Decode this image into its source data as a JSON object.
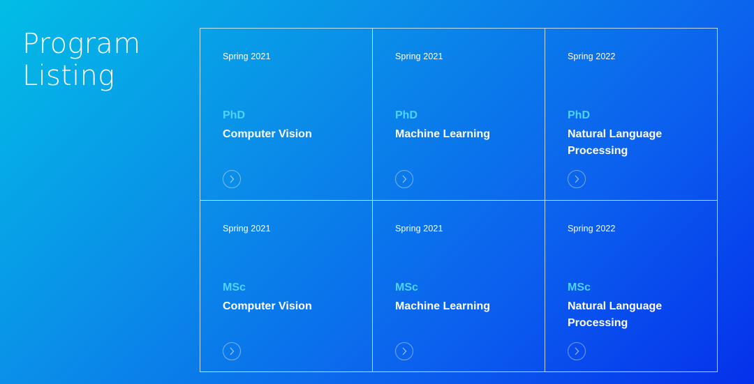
{
  "page": {
    "title": "Program Listing"
  },
  "colors": {
    "degree_accent": "#4fd3ff",
    "text": "#ffffff",
    "gradient_start": "#02bde6",
    "gradient_end": "#0530ec"
  },
  "programs": [
    {
      "term": "Spring 2021",
      "degree": "PhD",
      "name": "Computer Vision",
      "icon": "chevron-right-circle-icon"
    },
    {
      "term": "Spring 2021",
      "degree": "PhD",
      "name": "Machine Learning",
      "icon": "chevron-right-circle-icon"
    },
    {
      "term": "Spring 2022",
      "degree": "PhD",
      "name": "Natural Language Processing",
      "icon": "chevron-right-circle-icon"
    },
    {
      "term": "Spring 2021",
      "degree": "MSc",
      "name": "Computer Vision",
      "icon": "chevron-right-circle-icon"
    },
    {
      "term": "Spring 2021",
      "degree": "MSc",
      "name": "Machine Learning",
      "icon": "chevron-right-circle-icon"
    },
    {
      "term": "Spring 2022",
      "degree": "MSc",
      "name": "Natural Language Processing",
      "icon": "chevron-right-circle-icon"
    }
  ]
}
